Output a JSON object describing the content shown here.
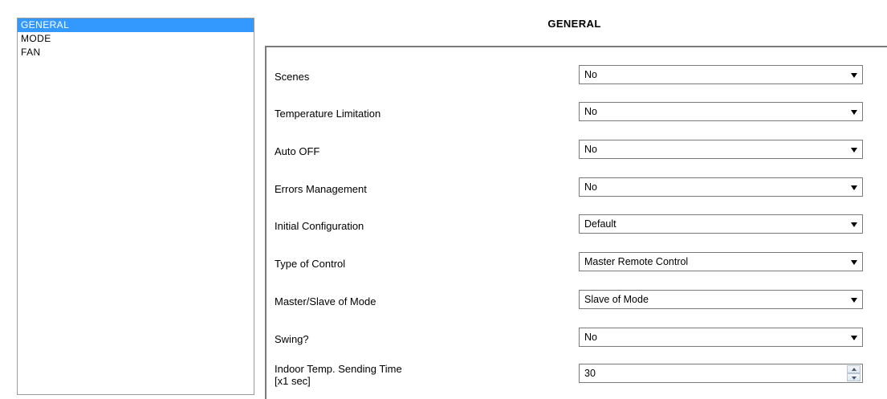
{
  "sidebar": {
    "items": [
      {
        "label": "GENERAL",
        "selected": true
      },
      {
        "label": "MODE",
        "selected": false
      },
      {
        "label": "FAN",
        "selected": false
      }
    ]
  },
  "page_title": "GENERAL",
  "params": [
    {
      "label": "Scenes",
      "value": "No"
    },
    {
      "label": "Temperature Limitation",
      "value": "No"
    },
    {
      "label": "Auto OFF",
      "value": "No"
    },
    {
      "label": "Errors Management",
      "value": "No"
    },
    {
      "label": "Initial Configuration",
      "value": "Default"
    },
    {
      "label": "Type of Control",
      "value": "Master Remote Control"
    },
    {
      "label": "Master/Slave of Mode",
      "value": "Slave of Mode"
    },
    {
      "label": "Swing?",
      "value": "No"
    }
  ],
  "sending_time": {
    "label_line1": "Indoor Temp. Sending Time",
    "label_line2": "[x1 sec]",
    "value": "30"
  },
  "colors": {
    "selection": "#3399ff"
  }
}
